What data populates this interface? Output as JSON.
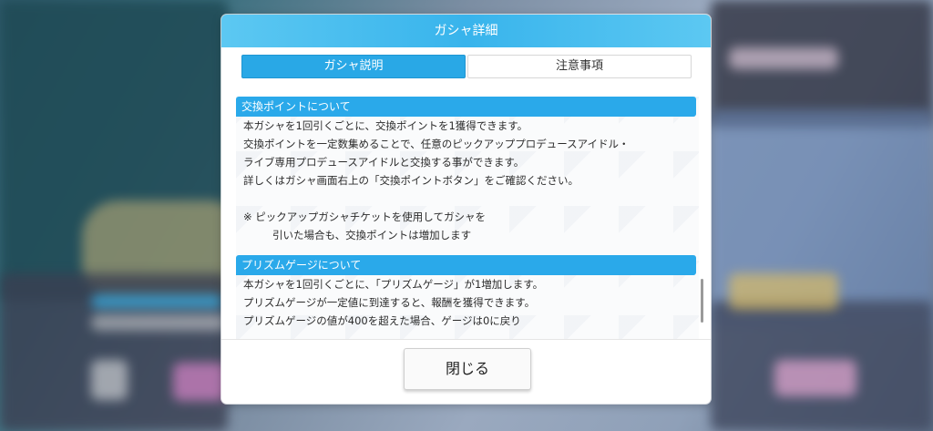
{
  "dialog": {
    "title": "ガシャ詳細",
    "tabs": [
      {
        "label": "ガシャ説明",
        "active": true
      },
      {
        "label": "注意事項",
        "active": false
      }
    ],
    "sections": [
      {
        "title": "交換ポイントについて",
        "lines": [
          "本ガシャを1回引くごとに、交換ポイントを1獲得できます。",
          "交換ポイントを一定数集めることで、任意のピックアッププロデュースアイドル・",
          "ライブ専用プロデュースアイドルと交換する事ができます。",
          "詳しくはガシャ画面右上の「交換ポイントボタン」をご確認ください。"
        ],
        "note_line1": "※ ピックアップガシャチケットを使用してガシャを",
        "note_line2": "引いた場合も、交換ポイントは増加します"
      },
      {
        "title": "プリズムゲージについて",
        "lines": [
          "本ガシャを1回引くごとに、「プリズムゲージ」が1増加します。",
          "プリズムゲージが一定値に到達すると、報酬を獲得できます。",
          "プリズムゲージの値が400を超えた場合、ゲージは0に戻り"
        ]
      }
    ],
    "close_label": "閉じる"
  },
  "colors": {
    "accent": "#29a8e6",
    "header": "#38b4ec"
  }
}
